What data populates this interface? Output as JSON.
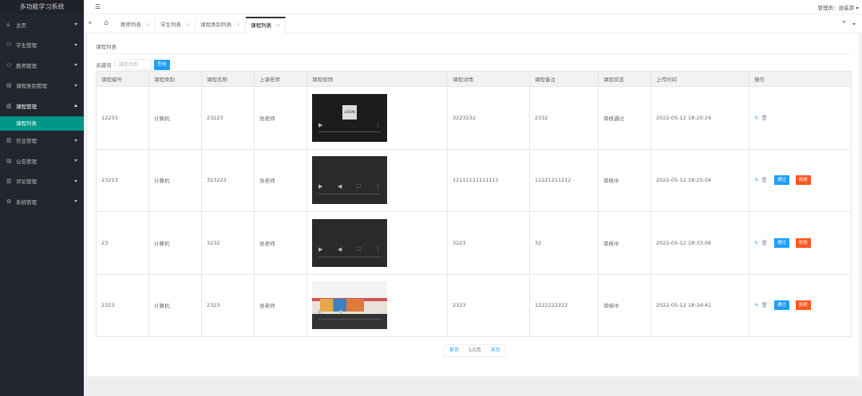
{
  "app": {
    "title": "多功能学习系统"
  },
  "sidebar": {
    "items": [
      {
        "label": "主页",
        "icon": "home-icon"
      },
      {
        "label": "学生管理",
        "icon": "user-icon"
      },
      {
        "label": "教师管理",
        "icon": "user-icon"
      },
      {
        "label": "课程类别管理",
        "icon": "list-icon"
      },
      {
        "label": "课程管理",
        "icon": "book-icon"
      },
      {
        "label": "作业管理",
        "icon": "doc-icon"
      },
      {
        "label": "公告管理",
        "icon": "bell-icon"
      },
      {
        "label": "评论管理",
        "icon": "comment-icon"
      },
      {
        "label": "系统管理",
        "icon": "gear-icon"
      }
    ],
    "active_sub": "课程列表"
  },
  "header": {
    "admin": "管理员：逍遥游"
  },
  "tabs": [
    {
      "label": "教师列表"
    },
    {
      "label": "学生列表"
    },
    {
      "label": "课程类别列表"
    },
    {
      "label": "课程列表"
    }
  ],
  "main": {
    "breadcrumb": "课程列表",
    "search_label": "关键词",
    "search_placeholder": "课程名称",
    "search_button": "查询",
    "columns": [
      "课程编号",
      "课程类别",
      "课程名称",
      "上课老师",
      "课程视频",
      "课程详情",
      "课程备注",
      "课程状态",
      "上传时间",
      "操作"
    ],
    "rows": [
      {
        "id": "12233",
        "category": "计算机",
        "name": "23223",
        "teacher": "张老师",
        "detail": "3223232",
        "note": "2332",
        "status": "审核通过",
        "time": "2022-05-12 18:20:24"
      },
      {
        "id": "23223",
        "category": "计算机",
        "name": "323223",
        "teacher": "张老师",
        "detail": "12111111111111",
        "note": "11221211212",
        "status": "审核中",
        "time": "2022-05-12 18:25:04"
      },
      {
        "id": "23",
        "category": "计算机",
        "name": "3232",
        "teacher": "张老师",
        "detail": "3223",
        "note": "32",
        "status": "审核中",
        "time": "2022-05-12 18:33:06"
      },
      {
        "id": "2323",
        "category": "计算机",
        "name": "2323",
        "teacher": "张老师",
        "detail": "2323",
        "note": "1222222222",
        "status": "审核中",
        "time": "2022-05-12 18:34:41"
      }
    ],
    "approve_label": "通过",
    "reject_label": "拒绝",
    "video_logo_text": "aiSION"
  },
  "pager": {
    "first": "首页",
    "info": "1/1页",
    "last": "末页"
  }
}
